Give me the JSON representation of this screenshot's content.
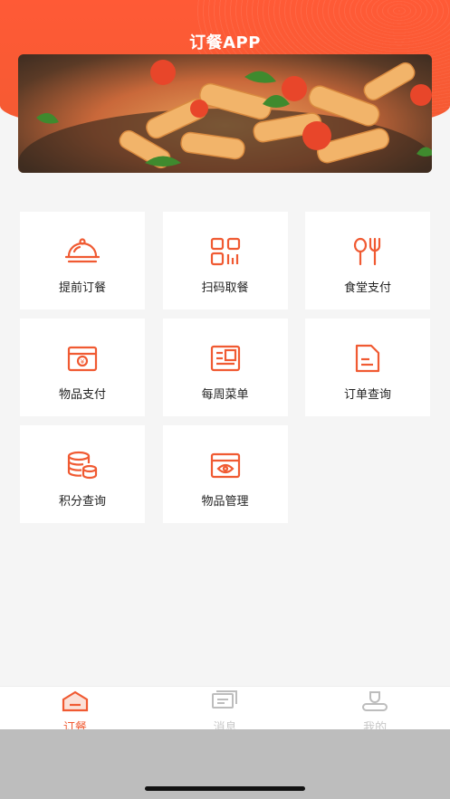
{
  "header": {
    "title": "订餐APP"
  },
  "menu": [
    {
      "label": "提前订餐",
      "icon": "cloche-icon"
    },
    {
      "label": "扫码取餐",
      "icon": "qr-scan-icon"
    },
    {
      "label": "食堂支付",
      "icon": "spoon-fork-icon"
    },
    {
      "label": "物品支付",
      "icon": "yen-box-icon"
    },
    {
      "label": "每周菜单",
      "icon": "weekly-menu-icon"
    },
    {
      "label": "订单查询",
      "icon": "document-icon"
    },
    {
      "label": "积分查询",
      "icon": "coins-icon"
    },
    {
      "label": "物品管理",
      "icon": "eye-box-icon"
    }
  ],
  "tabs": [
    {
      "label": "订餐",
      "icon": "home-icon",
      "active": true
    },
    {
      "label": "消息",
      "icon": "message-icon",
      "active": false
    },
    {
      "label": "我的",
      "icon": "user-icon",
      "active": false
    }
  ],
  "colors": {
    "accent": "#f05a32",
    "inactive": "#c8c8c8"
  }
}
